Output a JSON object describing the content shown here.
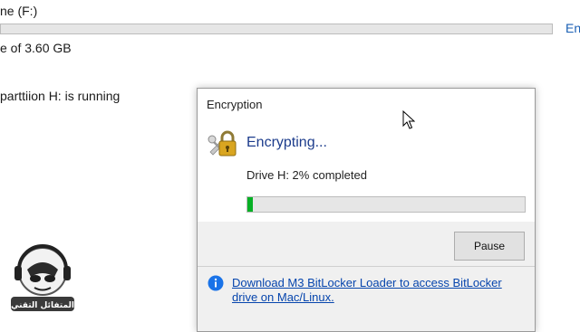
{
  "background": {
    "drive_name": "ne (F:)",
    "link_fragment": "En",
    "capacity_text": "e of 3.60 GB",
    "status_text": "parttiion H: is running"
  },
  "dialog": {
    "title": "Encryption",
    "heading": "Encrypting...",
    "progress_text": "Drive H: 2% completed",
    "progress_fraction": 0.02,
    "pause_label": "Pause",
    "info_link": "Download M3 BitLocker Loader to access BitLocker drive on Mac/Linux."
  },
  "icons": {
    "lock": "lock-with-keys-icon",
    "info": "info-icon",
    "cursor": "mouse-pointer-icon"
  },
  "watermark": {
    "text": "المتفائل التقني"
  },
  "colors": {
    "heading": "#1c3c8c",
    "link": "#0645ad",
    "info_circle": "#1a73e8",
    "progress_fill": "#06b025"
  }
}
